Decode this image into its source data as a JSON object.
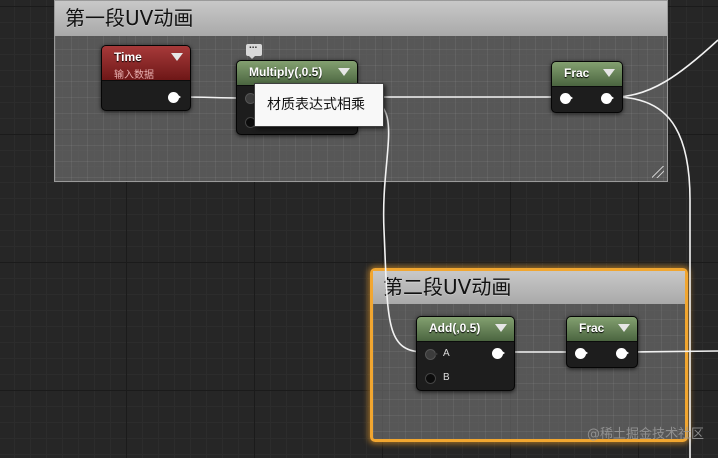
{
  "comments": {
    "first": {
      "title": "第一段UV动画"
    },
    "second": {
      "title": "第二段UV动画"
    }
  },
  "nodes": {
    "time": {
      "title": "Time",
      "subtitle": "输入数据"
    },
    "multiply": {
      "title": "Multiply(,0.5)"
    },
    "frac1": {
      "title": "Frac"
    },
    "add": {
      "title": "Add(,0.5)",
      "pin_a": "A",
      "pin_b": "B"
    },
    "frac2": {
      "title": "Frac"
    }
  },
  "tooltip": {
    "text": "材质表达式相乘"
  },
  "watermark": {
    "text": "@稀土掘金技术社区"
  },
  "colors": {
    "background": "#262626",
    "comment_header": "#b9b9b9",
    "selection_outline": "#f1a630",
    "material_node_header": "#5f7c52",
    "input_node_header": "#8b2525",
    "wire": "#ffffff"
  },
  "icons": {
    "dropdown": "triangle-down",
    "comment_bubble": "speech-bubble-ellipsis",
    "resize": "diagonal-grip"
  }
}
